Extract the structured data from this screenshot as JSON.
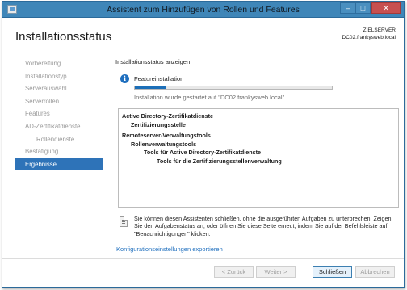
{
  "window": {
    "title": "Assistent zum Hinzufügen von Rollen und Features",
    "controls": {
      "minimize": "‒",
      "maximize": "□",
      "close": "✕"
    }
  },
  "header": {
    "page_title": "Installationsstatus",
    "target_label": "ZIELSERVER",
    "target_server": "DC02.frankysweb.local"
  },
  "sidebar": {
    "items": [
      {
        "label": "Vorbereitung",
        "state": "disabled"
      },
      {
        "label": "Installationstyp",
        "state": "disabled"
      },
      {
        "label": "Serverauswahl",
        "state": "disabled"
      },
      {
        "label": "Serverrollen",
        "state": "disabled"
      },
      {
        "label": "Features",
        "state": "disabled"
      },
      {
        "label": "AD-Zertifikatdienste",
        "state": "disabled"
      },
      {
        "label": "Rollendienste",
        "state": "disabled"
      },
      {
        "label": "Bestätigung",
        "state": "disabled"
      },
      {
        "label": "Ergebnisse",
        "state": "active"
      }
    ]
  },
  "main": {
    "section_label": "Installationsstatus anzeigen",
    "feature_label": "Featureinstallation",
    "progress_fraction": 0.16,
    "status_text": "Installation wurde gestartet auf \"DC02.frankysweb.local\"",
    "results": [
      {
        "text": "Active Directory-Zertifikatdienste",
        "level": 0
      },
      {
        "text": "Zertifizierungsstelle",
        "level": 1
      },
      {
        "text": "Remoteserver-Verwaltungstools",
        "level": 0
      },
      {
        "text": "Rollenverwaltungstools",
        "level": 1
      },
      {
        "text": "Tools für Active Directory-Zertifikatdienste",
        "level": 2
      },
      {
        "text": "Tools für die Zertifizierungsstellenverwaltung",
        "level": 3
      }
    ],
    "note_text": "Sie können diesen Assistenten schließen, ohne die ausgeführten Aufgaben zu unterbrechen. Zeigen Sie den Aufgabenstatus an, oder öffnen Sie diese Seite erneut, indem Sie auf der Befehlsleiste auf \"Benachrichtigungen\" klicken.",
    "export_link": "Konfigurationseinstellungen exportieren"
  },
  "footer": {
    "back_label": "< Zurück",
    "next_label": "Weiter >",
    "finish_label": "Schließen",
    "cancel_label": "Abbrechen"
  },
  "colors": {
    "titlebar": "#3f86b8",
    "accent": "#2e73b8",
    "progress": "#1c6fb8",
    "link": "#1f6fbe"
  }
}
